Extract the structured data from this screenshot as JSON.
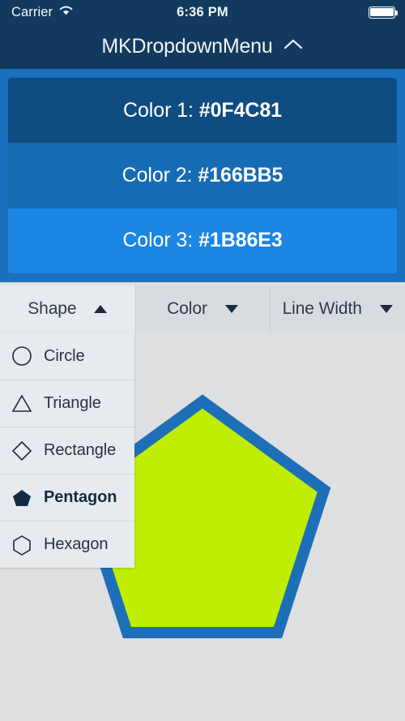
{
  "status_bar": {
    "carrier": "Carrier",
    "wifi_icon": "wifi-icon",
    "time": "6:36 PM",
    "battery_icon": "battery-full-icon"
  },
  "nav_bar": {
    "title": "MKDropdownMenu",
    "caret_icon": "chevron-up-icon"
  },
  "color_dropdown": {
    "expanded": true,
    "panel_color": "#1A6FBE",
    "items": [
      {
        "label": "Color 1: ",
        "hex": "#0F4C81",
        "background": "#0F4C81"
      },
      {
        "label": "Color 2: ",
        "hex": "#166BB5",
        "background": "#166BB5"
      },
      {
        "label": "Color 3: ",
        "hex": "#1B86E3",
        "background": "#1B86E3"
      }
    ]
  },
  "toolbar": {
    "buttons": [
      {
        "label": "Shape",
        "arrow": "triangle-up-icon",
        "expanded": true
      },
      {
        "label": "Color",
        "arrow": "triangle-down-icon",
        "expanded": false
      },
      {
        "label": "Line Width",
        "arrow": "triangle-down-icon",
        "expanded": false
      }
    ]
  },
  "shape_dropdown": {
    "expanded": true,
    "items": [
      {
        "label": "Circle",
        "icon": "circle-icon",
        "selected": false
      },
      {
        "label": "Triangle",
        "icon": "triangle-icon",
        "selected": false
      },
      {
        "label": "Rectangle",
        "icon": "diamond-icon",
        "selected": false
      },
      {
        "label": "Pentagon",
        "icon": "pentagon-icon",
        "selected": true
      },
      {
        "label": "Hexagon",
        "icon": "hexagon-icon",
        "selected": false
      }
    ]
  },
  "canvas": {
    "background": "#DEDFE1",
    "shape": "pentagon",
    "fill_color": "#BFEE04",
    "stroke_color": "#1D6FB8",
    "stroke_width": 14
  }
}
